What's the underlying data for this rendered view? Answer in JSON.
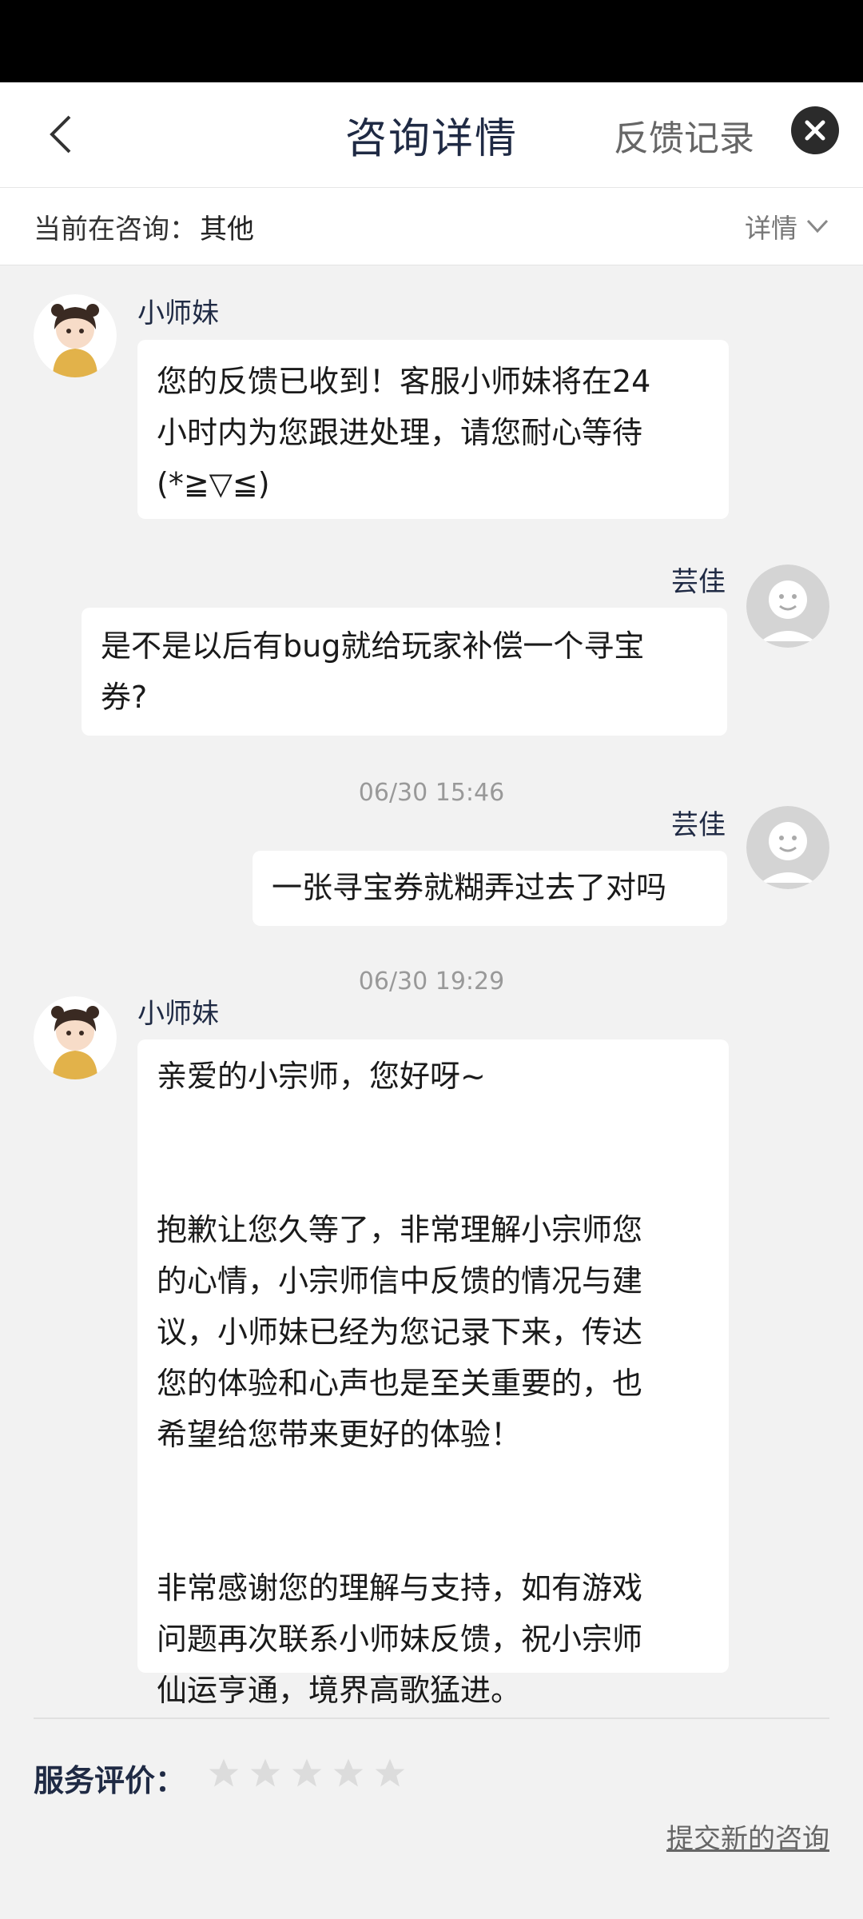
{
  "header": {
    "title": "咨询详情",
    "feedback_record": "反馈记录"
  },
  "topic": {
    "prefix": "当前在咨询：",
    "value": "其他",
    "details": "详情"
  },
  "messages": [
    {
      "sender": "小师妹",
      "text": "您的反馈已收到！客服小师妹将在24\n小时内为您跟进处理，请您耐心等待\n(*≧▽≦)"
    },
    {
      "sender": "芸佳",
      "text": "是不是以后有bug就给玩家补偿一个寻宝\n券?"
    },
    {
      "time": "06/30 15:46"
    },
    {
      "sender": "芸佳",
      "text": "一张寻宝券就糊弄过去了对吗"
    },
    {
      "time": "06/30 19:29"
    },
    {
      "sender": "小师妹",
      "text": "亲爱的小宗师，您好呀~\n\n\n抱歉让您久等了，非常理解小宗师您\n的心情，小宗师信中反馈的情况与建\n议，小师妹已经为您记录下来，传达\n您的体验和心声也是至关重要的，也\n希望给您带来更好的体验！\n\n\n非常感谢您的理解与支持，如有游戏\n问题再次联系小师妹反馈，祝小宗师\n仙运亨通，境界高歌猛进。"
    }
  ],
  "rating": {
    "label": "服务评价：",
    "stars_filled": 0,
    "stars_total": 5
  },
  "new_consult": "提交新的咨询",
  "colors": {
    "accent_text": "#1f2a44",
    "background": "#f2f2f2",
    "bubble": "#ffffff",
    "star_empty": "#dcdcdc"
  }
}
